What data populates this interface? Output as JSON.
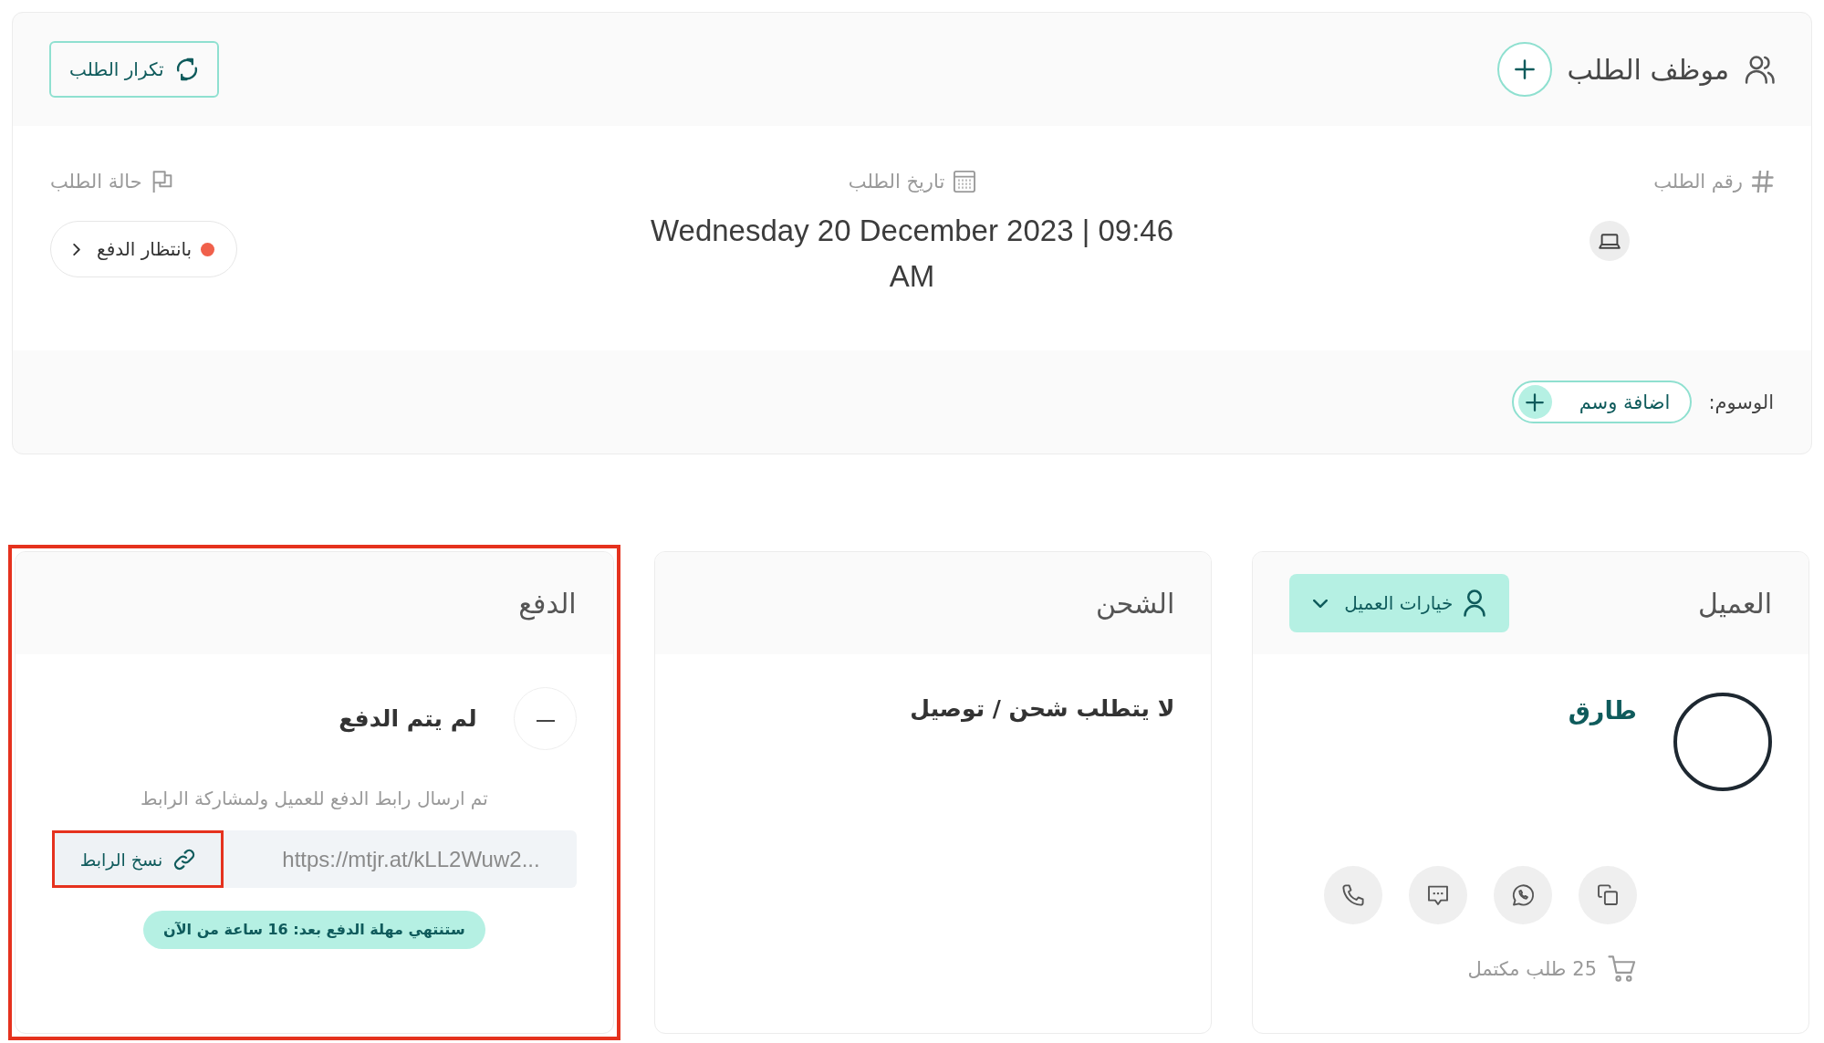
{
  "order_header": {
    "title": "موظف الطلب",
    "reorder_button": "تكرار الطلب"
  },
  "order_info": [
    {
      "kind": "number",
      "label": "رقم الطلب"
    },
    {
      "kind": "date",
      "label": "تاريخ الطلب",
      "value": "Wednesday 20 December 2023 | 09:46 AM"
    },
    {
      "kind": "status",
      "label": "حالة الطلب",
      "value": "بانتظار الدفع",
      "color": "#f0604b"
    }
  ],
  "tags": {
    "label": "الوسوم:",
    "add_button": "اضافة وسم"
  },
  "customer": {
    "title": "العميل",
    "options_button": "خيارات العميل",
    "name": "طارق",
    "completed_orders": "25 طلب مكتمل"
  },
  "shipping": {
    "title": "الشحن",
    "note": "لا يتطلب شحن / توصيل"
  },
  "payment": {
    "title": "الدفع",
    "highlighted": true,
    "status": "لم يتم الدفع",
    "note": "تم ارسال رابط الدفع للعميل ولمشاركة الرابط",
    "link": "https://mtjr.at/kLL2Wuw2...",
    "copy_button": {
      "label": "نسخ الرابط",
      "highlighted": true
    },
    "deadline": "ستنتهي مهلة الدفع بعد: 16 ساعة من الآن"
  }
}
